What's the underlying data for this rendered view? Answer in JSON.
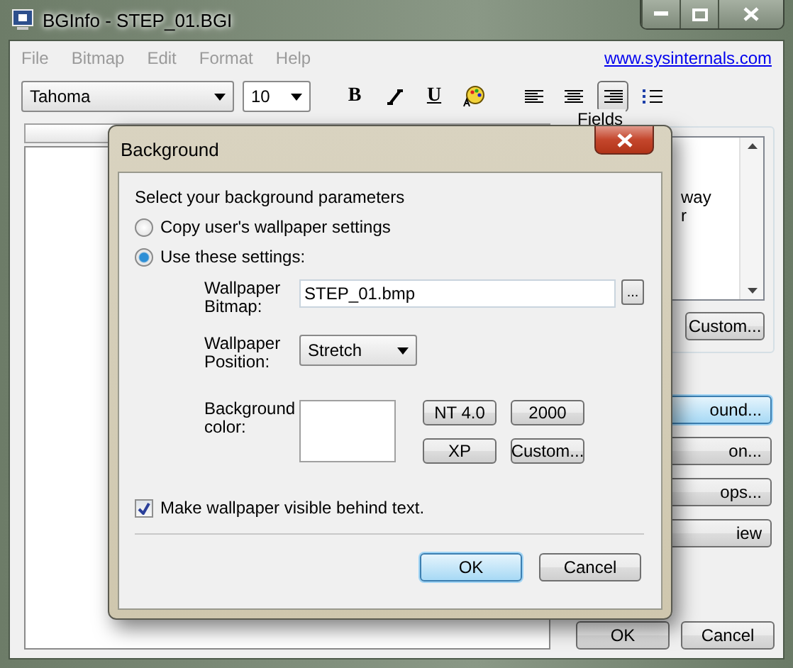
{
  "window": {
    "title": "BGInfo - STEP_01.BGI"
  },
  "menu": [
    "File",
    "Bitmap",
    "Edit",
    "Format",
    "Help"
  ],
  "link": "www.sysinternals.com",
  "toolbar": {
    "font": "Tahoma",
    "size": "10",
    "format": [
      {
        "kind": "bold",
        "label": "B"
      },
      {
        "kind": "italic"
      },
      {
        "kind": "underline",
        "label": "U"
      },
      {
        "kind": "palette"
      }
    ],
    "align": [
      {
        "kind": "left",
        "selected": false
      },
      {
        "kind": "center",
        "selected": false
      },
      {
        "kind": "right",
        "selected": true
      }
    ]
  },
  "fields": {
    "legend": "Fields",
    "items": [
      "way",
      "r"
    ],
    "custom": "Custom..."
  },
  "side_buttons": [
    {
      "label": "ound...",
      "focused": true
    },
    {
      "label": "on...",
      "focused": false
    },
    {
      "label": "ops...",
      "focused": false
    },
    {
      "label": "iew",
      "focused": false
    }
  ],
  "footer_buttons": [
    "OK",
    "Cancel"
  ],
  "dialog": {
    "title": "Background",
    "prompt": "Select your background parameters",
    "radios": [
      {
        "label": "Copy user's wallpaper settings",
        "selected": false
      },
      {
        "label": "Use these settings:",
        "selected": true
      }
    ],
    "bitmap": {
      "label": [
        "Wallpaper",
        "Bitmap:"
      ],
      "value": "STEP_01.bmp",
      "browse": "..."
    },
    "position": {
      "label": [
        "Wallpaper",
        "Position:"
      ],
      "value": "Stretch"
    },
    "color": {
      "label": [
        "Background",
        "color:"
      ],
      "presets": [
        "NT 4.0",
        "2000",
        "XP",
        "Custom..."
      ]
    },
    "checkbox": {
      "label": "Make wallpaper visible behind text.",
      "checked": true
    },
    "buttons": [
      {
        "label": "OK",
        "default": true
      },
      {
        "label": "Cancel",
        "default": false
      }
    ]
  }
}
